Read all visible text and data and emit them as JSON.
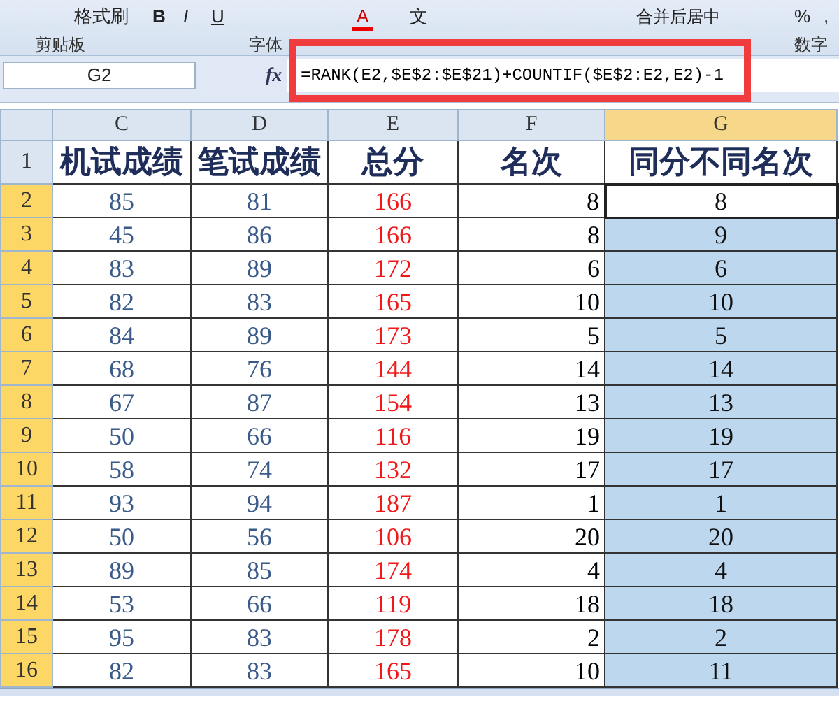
{
  "ribbon": {
    "buttons": [
      {
        "kind": "format-painter",
        "label": "格式刷"
      },
      {
        "kind": "bold",
        "label": "B"
      },
      {
        "kind": "italic",
        "label": "I"
      },
      {
        "kind": "underline",
        "label": "U"
      },
      {
        "kind": "font-color",
        "label": "A"
      },
      {
        "kind": "phonetic",
        "label": "文"
      },
      {
        "kind": "merge",
        "label": "合并后居中"
      },
      {
        "kind": "percent",
        "label": "%"
      },
      {
        "kind": "comma",
        "label": ","
      }
    ],
    "groups": [
      {
        "label": "剪贴板"
      },
      {
        "label": "字体"
      },
      {
        "label": "数字"
      }
    ]
  },
  "formula_bar": {
    "name_box": "G2",
    "fx": "fx",
    "formula": "=RANK(E2,$E$2:$E$21)+COUNTIF($E$2:E2,E2)-1",
    "highlighted": true
  },
  "columns": [
    {
      "label": "C",
      "selected": false
    },
    {
      "label": "D",
      "selected": false
    },
    {
      "label": "E",
      "selected": false
    },
    {
      "label": "F",
      "selected": false
    },
    {
      "label": "G",
      "selected": true
    }
  ],
  "header_row": {
    "number": "1",
    "cells": [
      "机试成绩",
      "笔试成绩",
      "总分",
      "名次",
      "同分不同名次"
    ]
  },
  "rows": [
    {
      "number": "2",
      "selected": true,
      "active": true,
      "cells": [
        "85",
        "81",
        "166",
        "8",
        "8"
      ]
    },
    {
      "number": "3",
      "selected": true,
      "active": false,
      "cells": [
        "45",
        "86",
        "166",
        "8",
        "9"
      ]
    },
    {
      "number": "4",
      "selected": true,
      "active": false,
      "cells": [
        "83",
        "89",
        "172",
        "6",
        "6"
      ]
    },
    {
      "number": "5",
      "selected": true,
      "active": false,
      "cells": [
        "82",
        "83",
        "165",
        "10",
        "10"
      ]
    },
    {
      "number": "6",
      "selected": true,
      "active": false,
      "cells": [
        "84",
        "89",
        "173",
        "5",
        "5"
      ]
    },
    {
      "number": "7",
      "selected": true,
      "active": false,
      "cells": [
        "68",
        "76",
        "144",
        "14",
        "14"
      ]
    },
    {
      "number": "8",
      "selected": true,
      "active": false,
      "cells": [
        "67",
        "87",
        "154",
        "13",
        "13"
      ]
    },
    {
      "number": "9",
      "selected": true,
      "active": false,
      "cells": [
        "50",
        "66",
        "116",
        "19",
        "19"
      ]
    },
    {
      "number": "10",
      "selected": true,
      "active": false,
      "cells": [
        "58",
        "74",
        "132",
        "17",
        "17"
      ]
    },
    {
      "number": "11",
      "selected": true,
      "active": false,
      "cells": [
        "93",
        "94",
        "187",
        "1",
        "1"
      ]
    },
    {
      "number": "12",
      "selected": true,
      "active": false,
      "cells": [
        "50",
        "56",
        "106",
        "20",
        "20"
      ]
    },
    {
      "number": "13",
      "selected": true,
      "active": false,
      "cells": [
        "89",
        "85",
        "174",
        "4",
        "4"
      ]
    },
    {
      "number": "14",
      "selected": true,
      "active": false,
      "cells": [
        "53",
        "66",
        "119",
        "18",
        "18"
      ]
    },
    {
      "number": "15",
      "selected": true,
      "active": false,
      "cells": [
        "95",
        "83",
        "178",
        "2",
        "2"
      ]
    },
    {
      "number": "16",
      "selected": true,
      "active": false,
      "cells": [
        "82",
        "83",
        "165",
        "10",
        "11"
      ]
    }
  ]
}
